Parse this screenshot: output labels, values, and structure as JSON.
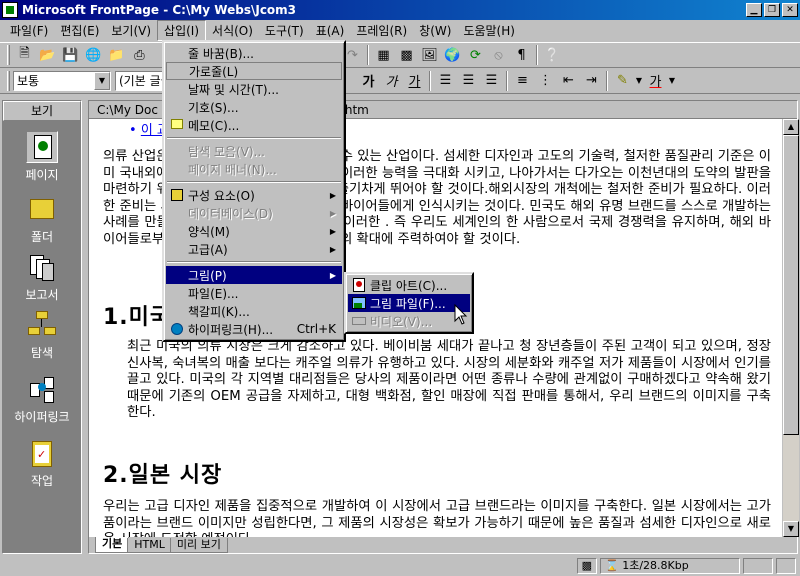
{
  "window": {
    "title": "Microsoft FrontPage - C:\\My Webs\\Jcom3"
  },
  "menubar": [
    {
      "label": "파일(F)"
    },
    {
      "label": "편집(E)"
    },
    {
      "label": "보기(V)"
    },
    {
      "label": "삽입(I)"
    },
    {
      "label": "서식(O)"
    },
    {
      "label": "도구(T)"
    },
    {
      "label": "표(A)"
    },
    {
      "label": "프레임(R)"
    },
    {
      "label": "창(W)"
    },
    {
      "label": "도움말(H)"
    }
  ],
  "toolbar": {
    "style_combo": "보통",
    "font_combo": "(기본 글꼴)",
    "bold": "가",
    "italic": "가",
    "underline": "가",
    "font_color": "가"
  },
  "viewbar": {
    "header": "보기",
    "items": [
      {
        "label": "페이지"
      },
      {
        "label": "폴더"
      },
      {
        "label": "보고서"
      },
      {
        "label": "탐색"
      },
      {
        "label": "하이퍼링크"
      },
      {
        "label": "작업"
      }
    ]
  },
  "page": {
    "title_left": "C:\\My Doc",
    "title_right": "림삽입.htm",
    "bullet_stub": "이 교",
    "para1": "의류 산업은 이 강남 섬유의 능력을 활용할 수 있는 산업이다. 섬세한 디자인과 고도의 기술력, 철저한 품질관리 기준은 이미 국내외에 널리 알려졌다. 따라서 당사는 이러한 능력을 극대화 시키고, 나아가서는 다가오는 이천년대의 도약의 발판을 마련하기 위하여 전 직원은 하나로 뭉쳐서 출기차게 뛰어야 할 것이다.해외시장의 개척에는 철저한 준비가 필요하다. 이러한 준비는 새로운 브랜드를 개발시켜, 국제 바이어들에게 인식시키는 것이다. 민국도 해외 유명 브랜드를 스스로 개발하는 사례를 만들어 나가야 한다. 이를 위해서는 이러한 . 즉 우리도 세계인의 한 사람으로서 국제 경쟁력을 유지하며, 해외 바이어들로부터 안정적인 자금 확보와 생산성의 확대에 주력하여야 할 것이다.",
    "heading1": "1.미국",
    "para2": "최근 미국의 의류 시장은 크게 감소하고 있다. 베이비붐 세대가 끝나고 청 장년층들이 주된 고객이 되고 있으며, 정장 신사복, 숙녀복의 매출 보다는 캐주얼 의류가 유행하고 있다. 시장의 세분화와 캐주얼 저가 제품들이 시장에서 인기를 끌고 있다. 미국의 각 지역별 대리점들은 당사의 제품이라면 어떤 종류나 수량에 관계없이 구매하겠다고 약속해 왔기 때문에 기존의 OEM 공급을 자제하고, 대형 백화점, 할인 매장에 직접 판매를 통해서, 우리 브랜드의 이미지를 구축한다.",
    "heading2": "2.일본 시장",
    "para3": "우리는 고급 디자인 제품을 집중적으로 개발하여 이 시장에서 고급 브랜드라는 이미지를 구축한다. 일본 시장에서는 고가품이라는 브랜드 이미지만 성립한다면, 그 제품의 시장성은 확보가 가능하기 때문에 높은 품질과 섬세한 디자인으로 새로운 시장에 도전할 예정이다."
  },
  "tabs": [
    {
      "label": "기본"
    },
    {
      "label": "HTML"
    },
    {
      "label": "미리 보기"
    }
  ],
  "status": {
    "time": "1초/28.8Kbp"
  },
  "insert_menu": {
    "items": [
      {
        "label": "줄 바꿈(B)..."
      },
      {
        "label": "가로줄(L)"
      },
      {
        "label": "날짜 및 시간(T)..."
      },
      {
        "label": "기호(S)..."
      },
      {
        "label": "메모(C)..."
      },
      {
        "label": "탐색 모음(V)..."
      },
      {
        "label": "페이지 배너(N)..."
      },
      {
        "label": "구성 요소(O)"
      },
      {
        "label": "데이터베이스(D)"
      },
      {
        "label": "양식(M)"
      },
      {
        "label": "고급(A)"
      },
      {
        "label": "그림(P)"
      },
      {
        "label": "파일(E)..."
      },
      {
        "label": "책갈피(K)..."
      },
      {
        "label": "하이퍼링크(H)...",
        "shortcut": "Ctrl+K"
      }
    ]
  },
  "picture_submenu": {
    "items": [
      {
        "label": "클립 아트(C)..."
      },
      {
        "label": "그림 파일(F)..."
      },
      {
        "label": "비디오(V)..."
      }
    ]
  },
  "colors": {
    "title_bar": "#000080",
    "menu_highlight": "#000080",
    "face": "#c0c0c0"
  }
}
